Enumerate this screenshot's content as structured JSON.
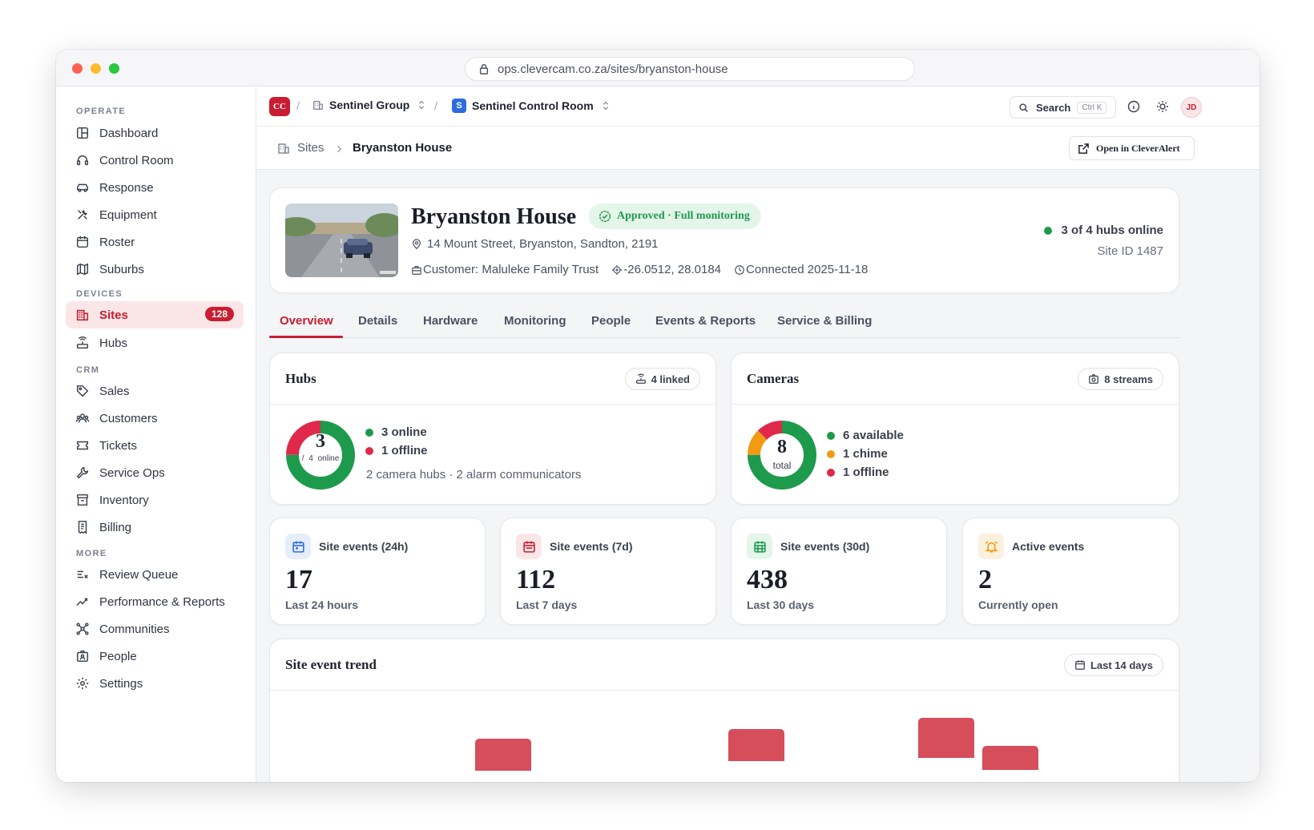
{
  "browser": {
    "url": "ops.clevercam.co.za/sites/bryanston-house"
  },
  "sidebar": {
    "sections": [
      {
        "label": "OPERATE",
        "items": [
          "Dashboard",
          "Control Room",
          "Response",
          "Equipment",
          "Roster",
          "Suburbs"
        ]
      },
      {
        "label": "DEVICES",
        "items": [
          "Sites",
          "Hubs"
        ]
      },
      {
        "label": "CRM",
        "items": [
          "Sales",
          "Customers",
          "Tickets",
          "Service Ops",
          "Inventory",
          "Billing"
        ]
      },
      {
        "label": "MORE",
        "items": [
          "Review Queue",
          "Performance & Reports",
          "Communities",
          "People",
          "Settings"
        ]
      }
    ],
    "sites_badge": "128"
  },
  "topbar": {
    "org_logo": "CC",
    "org": "Sentinel Group",
    "workspace_logo": "S",
    "workspace": "Sentinel Control Room",
    "search_label": "Search",
    "search_shortcut": "Ctrl K",
    "avatar_initials": "JD"
  },
  "breadcrumb": {
    "parent": "Sites",
    "current": "Bryanston House",
    "open_button": "Open in CleverAlert"
  },
  "site": {
    "name": "Bryanston House",
    "status": "Approved · Full monitoring",
    "address": "14 Mount Street, Bryanston, Sandton, 2191",
    "customer": "Customer: Maluleke Family Trust",
    "coords": "-26.0512, 28.0184",
    "connected": "Connected 2025-11-18",
    "hubs_online": "3 of 4 hubs online",
    "site_id": "Site ID 1487"
  },
  "tabs": [
    "Overview",
    "Details",
    "Hardware",
    "Monitoring",
    "People",
    "Events & Reports",
    "Service & Billing"
  ],
  "hubs_card": {
    "title": "Hubs",
    "chip": "4 linked",
    "center_num": "3",
    "center_sub": "/ 4 online",
    "legend": [
      "3 online",
      "1 offline"
    ],
    "note": "2 camera hubs · 2 alarm communicators",
    "online": 3,
    "offline": 1
  },
  "cameras_card": {
    "title": "Cameras",
    "chip": "8 streams",
    "center_num": "8",
    "center_sub": "total",
    "legend": [
      "6 available",
      "1 chime",
      "1 offline"
    ],
    "available": 6,
    "chime": 1,
    "offline": 1
  },
  "stats": [
    {
      "label": "Site events (24h)",
      "value": "17",
      "sub": "Last 24 hours"
    },
    {
      "label": "Site events (7d)",
      "value": "112",
      "sub": "Last 7 days"
    },
    {
      "label": "Site events (30d)",
      "value": "438",
      "sub": "Last 30 days"
    },
    {
      "label": "Active events",
      "value": "2",
      "sub": "Currently open"
    }
  ],
  "trend": {
    "title": "Site event trend",
    "chip": "Last 14 days"
  },
  "colors": {
    "accent": "#c81d31",
    "green": "#1e9a4c",
    "red": "#e0294a",
    "amber": "#f29b12"
  }
}
